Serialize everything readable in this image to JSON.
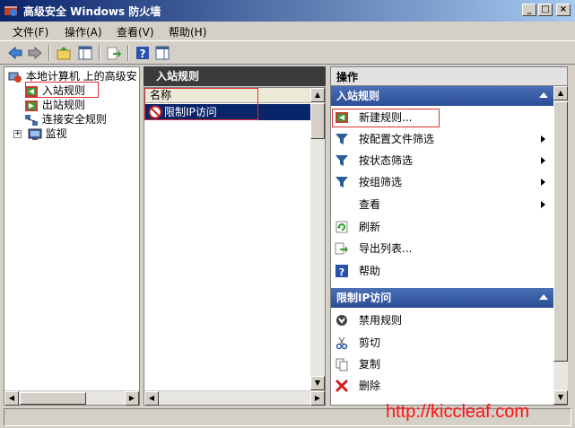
{
  "window": {
    "title": "高级安全 Windows 防火墙"
  },
  "menu": [
    "文件(F)",
    "操作(A)",
    "查看(V)",
    "帮助(H)"
  ],
  "tree": {
    "root": "本地计算机 上的高级安",
    "items": [
      "入站规则",
      "出站规则",
      "连接安全规则",
      "监视"
    ],
    "expander": "+"
  },
  "middle": {
    "header": "入站规则",
    "column": "名称",
    "rows": [
      "限制IP访问"
    ]
  },
  "actions": {
    "header": "操作",
    "section1": {
      "title": "入站规则",
      "items": [
        {
          "label": "新建规则...",
          "icon": "new-rule-icon"
        },
        {
          "label": "按配置文件筛选",
          "icon": "filter-icon",
          "submenu": true
        },
        {
          "label": "按状态筛选",
          "icon": "filter-icon",
          "submenu": true
        },
        {
          "label": "按组筛选",
          "icon": "filter-icon",
          "submenu": true
        },
        {
          "label": "查看",
          "icon": "",
          "submenu": true
        },
        {
          "label": "刷新",
          "icon": "refresh-icon"
        },
        {
          "label": "导出列表...",
          "icon": "export-icon"
        },
        {
          "label": "帮助",
          "icon": "help-icon"
        }
      ]
    },
    "section2": {
      "title": "限制IP访问",
      "items": [
        {
          "label": "禁用规则",
          "icon": "disable-icon"
        },
        {
          "label": "剪切",
          "icon": "cut-icon"
        },
        {
          "label": "复制",
          "icon": "copy-icon"
        },
        {
          "label": "删除",
          "icon": "delete-icon"
        }
      ]
    }
  },
  "watermark": "http://kiccleaf.com",
  "colors": {
    "title_start": "#0a246a",
    "section_bar": "#2b4e96",
    "highlight": "#0a246a",
    "red_box": "#e03030"
  }
}
